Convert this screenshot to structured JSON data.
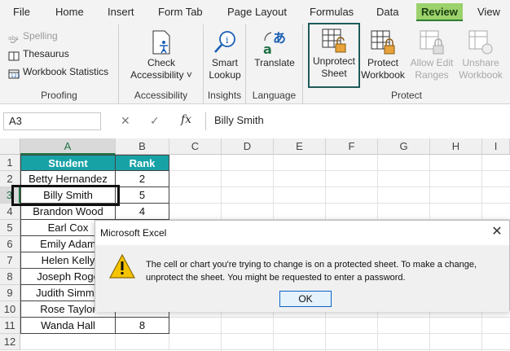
{
  "menu": {
    "tabs": [
      "File",
      "Home",
      "Insert",
      "Form Tab",
      "Page Layout",
      "Formulas",
      "Data",
      "Review",
      "View"
    ],
    "active": "Review"
  },
  "ribbon": {
    "proofing": {
      "label": "Proofing",
      "spelling": "Spelling",
      "thesaurus": "Thesaurus",
      "workbook_statistics": "Workbook Statistics"
    },
    "accessibility": {
      "label": "Accessibility",
      "check_line1": "Check",
      "check_line2": "Accessibility ˅"
    },
    "insights": {
      "label": "Insights",
      "smart_line1": "Smart",
      "smart_line2": "Lookup"
    },
    "language": {
      "label": "Language",
      "translate": "Translate"
    },
    "protect": {
      "label": "Protect",
      "unprotect_sheet_l1": "Unprotect",
      "unprotect_sheet_l2": "Sheet",
      "protect_workbook_l1": "Protect",
      "protect_workbook_l2": "Workbook",
      "allow_edit_l1": "Allow Edit",
      "allow_edit_l2": "Ranges",
      "unshare_l1": "Unshare",
      "unshare_l2": "Workbook"
    }
  },
  "formula_bar": {
    "name_box": "A3",
    "cancel": "✕",
    "enter": "✓",
    "fx": "fx",
    "value": "Billy Smith"
  },
  "sheet": {
    "columns": [
      "A",
      "B",
      "C",
      "D",
      "E",
      "F",
      "G",
      "H",
      "I"
    ],
    "rows": [
      "1",
      "2",
      "3",
      "4",
      "5",
      "6",
      "7",
      "8",
      "9",
      "10",
      "11",
      "12"
    ],
    "header": {
      "student": "Student",
      "rank": "Rank"
    },
    "records": [
      {
        "student": "Betty Hernandez",
        "rank": "2"
      },
      {
        "student": "Billy Smith",
        "rank": "5"
      },
      {
        "student": "Brandon Wood",
        "rank": "4"
      },
      {
        "student": "Earl Cox",
        "rank": ""
      },
      {
        "student": "Emily Adam",
        "rank": ""
      },
      {
        "student": "Helen Kelly",
        "rank": ""
      },
      {
        "student": "Joseph Roge",
        "rank": ""
      },
      {
        "student": "Judith Simmo",
        "rank": ""
      },
      {
        "student": "Rose Taylor",
        "rank": ""
      },
      {
        "student": "Wanda Hall",
        "rank": "8"
      }
    ],
    "selected_cell": "A3"
  },
  "dialog": {
    "title": "Microsoft Excel",
    "close": "✕",
    "message_line1": "The cell or chart you're trying to change is on a protected sheet. To make a change,",
    "message_line2": "unprotect the sheet. You might be requested to enter a  password.",
    "ok": "OK"
  },
  "colors": {
    "active_tab": "#9bd26b",
    "table_header": "#17a2a6",
    "excel_green": "#217346",
    "highlight_outline": "#1f5a5a"
  }
}
